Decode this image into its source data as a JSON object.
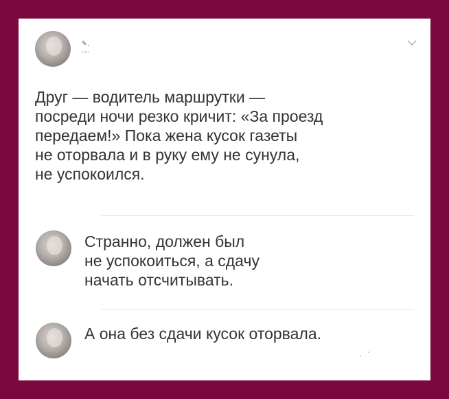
{
  "post": {
    "author_scribble": "✎ ,",
    "handle_scribble": "' ' ' ' '",
    "lines": [
      "Друг — водитель маршрутки —",
      "посреди ночи резко кричит: «За проезд",
      "передаем!» Пока жена кусок газеты",
      "не оторвала и в руку ему не сунула,",
      "не успокоился."
    ],
    "menu_icon": "chevron-down-icon"
  },
  "replies": [
    {
      "lines": [
        "Странно, должен был",
        "не успокоиться, а сдачу",
        "начать отсчитывать."
      ]
    },
    {
      "lines": [
        "А она без сдачи кусок оторвала."
      ]
    }
  ],
  "colors": {
    "frame": "#7a0a3e",
    "card": "#ffffff",
    "text": "#333333"
  }
}
